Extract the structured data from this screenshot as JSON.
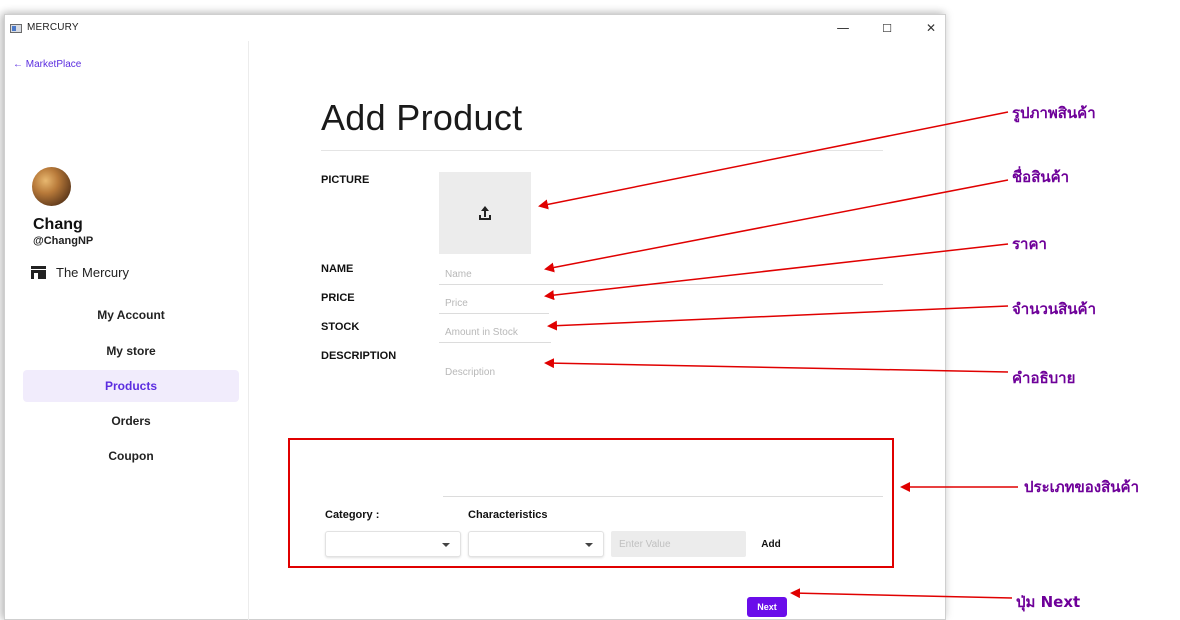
{
  "window": {
    "title": "MERCURY",
    "controls": {
      "minimize": "—",
      "maximize": "☐",
      "close": "✕"
    }
  },
  "sidebar": {
    "back_link": "← MarketPlace",
    "user": {
      "name": "Chang",
      "handle": "@ChangNP"
    },
    "store": {
      "name": "The Mercury"
    },
    "nav": [
      {
        "label": "My Account"
      },
      {
        "label": "My store"
      },
      {
        "label": "Products",
        "active": true
      },
      {
        "label": "Orders"
      },
      {
        "label": "Coupon"
      }
    ]
  },
  "form": {
    "title": "Add Product",
    "picture_label": "PICTURE",
    "name_label": "NAME",
    "name_placeholder": "Name",
    "price_label": "PRICE",
    "price_placeholder": "Price",
    "stock_label": "STOCK",
    "stock_placeholder": "Amount in Stock",
    "description_label": "DESCRIPTION",
    "description_placeholder": "Description",
    "category_label": "Category :",
    "characteristics_label": "Characteristics",
    "value_placeholder": "Enter Value",
    "add_label": "Add",
    "next_label": "Next"
  },
  "annotations": [
    {
      "text": "รูปภาพสินค้า"
    },
    {
      "text": "ชื่อสินค้า"
    },
    {
      "text": "ราคา"
    },
    {
      "text": "จำนวนสินค้า"
    },
    {
      "text": "คำอธิบาย"
    },
    {
      "text": "ประเภทของสินค้า"
    },
    {
      "text": "ปุ่ม Next"
    }
  ],
  "colors": {
    "accent": "#6a0dea",
    "link": "#5b2de0",
    "active_nav_bg": "#f1ecfc",
    "annotation_red": "#e00000",
    "annotation_text": "#6e0099"
  }
}
